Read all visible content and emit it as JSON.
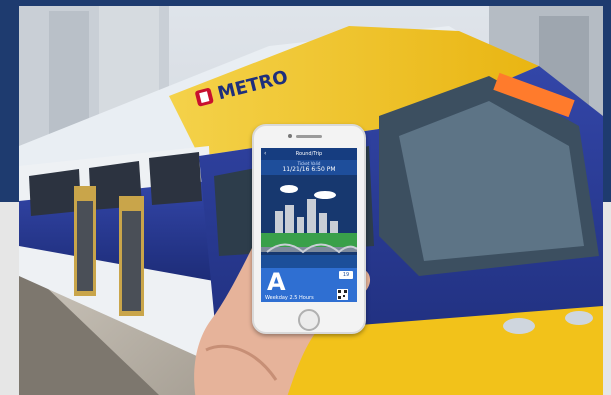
{
  "train": {
    "brand_logo_text": "METRO",
    "colors": {
      "body_blue": "#2a3f9b",
      "stripe_yellow": "#f2c21a",
      "roof_white": "#e9eef3"
    }
  },
  "phone": {
    "screen_title": "Round/Trip",
    "ticket_label": "Ticket Valid",
    "valid_until": "11/21/16 6:50 PM",
    "fare_letter": "A",
    "fare_type": "Weekday 2.5 Hours",
    "badge": "19",
    "icons": [
      "back-arrow-icon",
      "cloud-icon",
      "skyline-icon",
      "bridge-icon",
      "qr-code-icon"
    ]
  },
  "frame_colors": {
    "navy": "#1e3b6f",
    "grey": "#e6e6e6"
  }
}
